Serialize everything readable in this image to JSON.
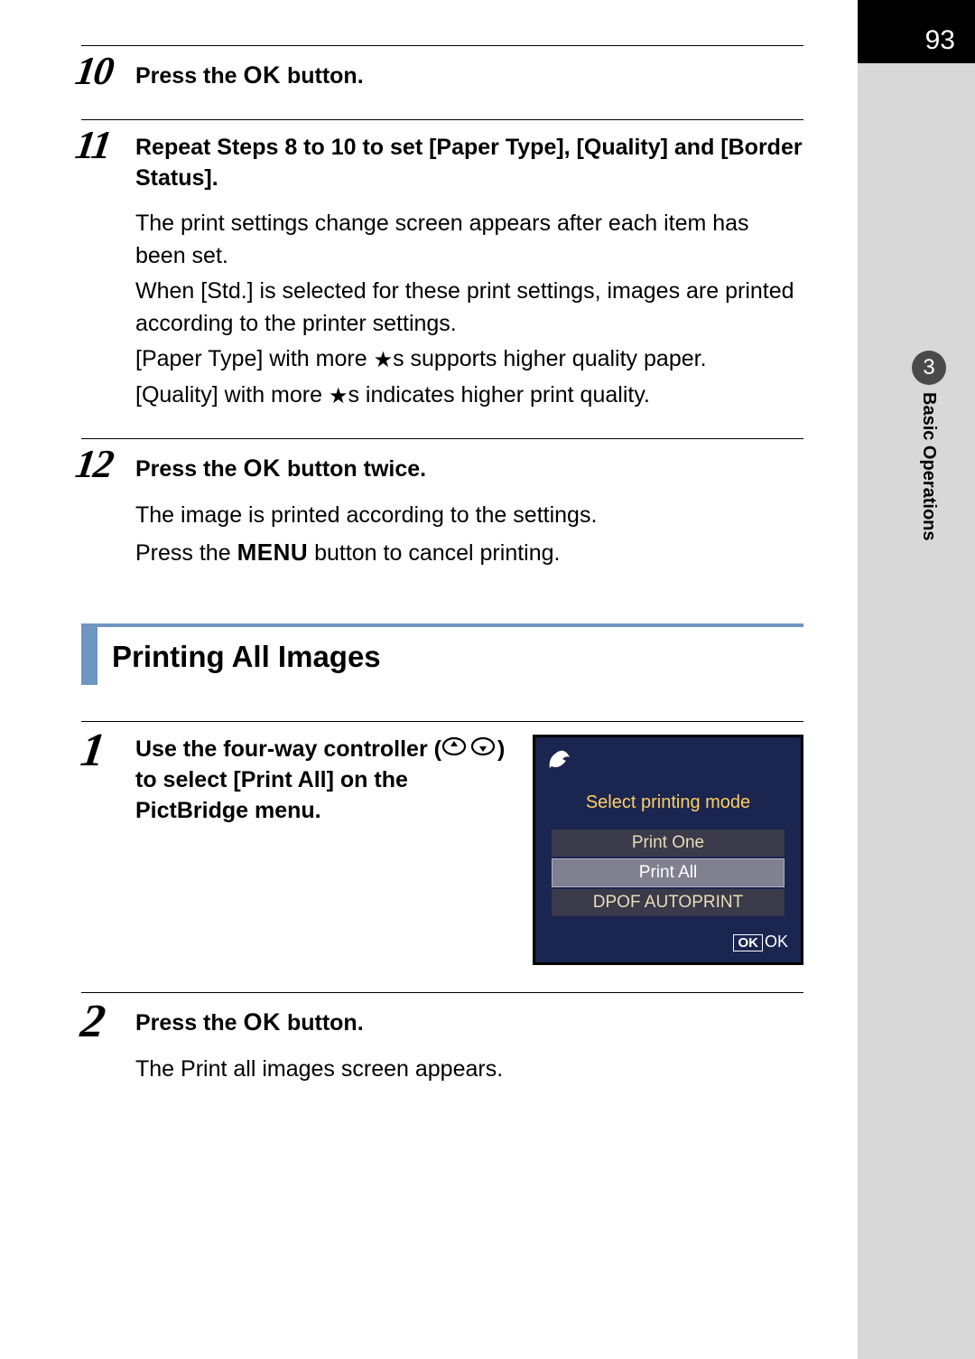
{
  "page_number": "93",
  "chapter": {
    "number": "3",
    "label": "Basic Operations"
  },
  "steps_a": [
    {
      "num": "10",
      "title_parts": {
        "pre": "Press the ",
        "ok": "OK",
        "post": " button."
      }
    },
    {
      "num": "11",
      "title": "Repeat Steps 8 to 10 to set [Paper Type], [Quality] and [Border Status].",
      "body": [
        "The print settings change screen appears after each item has been set.",
        "When [Std.] is selected for these print settings, images are printed according to the printer settings.",
        {
          "pre": "[Paper Type] with more ",
          "star": "★",
          "post": "s supports higher quality paper."
        },
        {
          "pre": "[Quality] with more ",
          "star": "★",
          "post": "s indicates higher print quality."
        }
      ]
    },
    {
      "num": "12",
      "title_parts": {
        "pre": "Press the ",
        "ok": "OK",
        "post": " button twice."
      },
      "body_plain": "The image is printed according to the settings.",
      "body_menu": {
        "pre": "Press the ",
        "menu": "MENU",
        "post": " button to cancel printing."
      }
    }
  ],
  "section_heading": "Printing All Images",
  "steps_b": [
    {
      "num": "1",
      "title_ctrl": {
        "pre": "Use the four-way controller (",
        "post": ") to select [Print All] on the PictBridge menu."
      }
    },
    {
      "num": "2",
      "title_parts": {
        "pre": "Press the ",
        "ok": "OK",
        "post": " button."
      },
      "body_plain": "The Print all images screen appears."
    }
  ],
  "screen": {
    "header": "Select printing mode",
    "items": [
      "Print One",
      "Print All",
      "DPOF AUTOPRINT"
    ],
    "selected_index": 1,
    "ok_box": "OK",
    "ok_text": "OK"
  }
}
